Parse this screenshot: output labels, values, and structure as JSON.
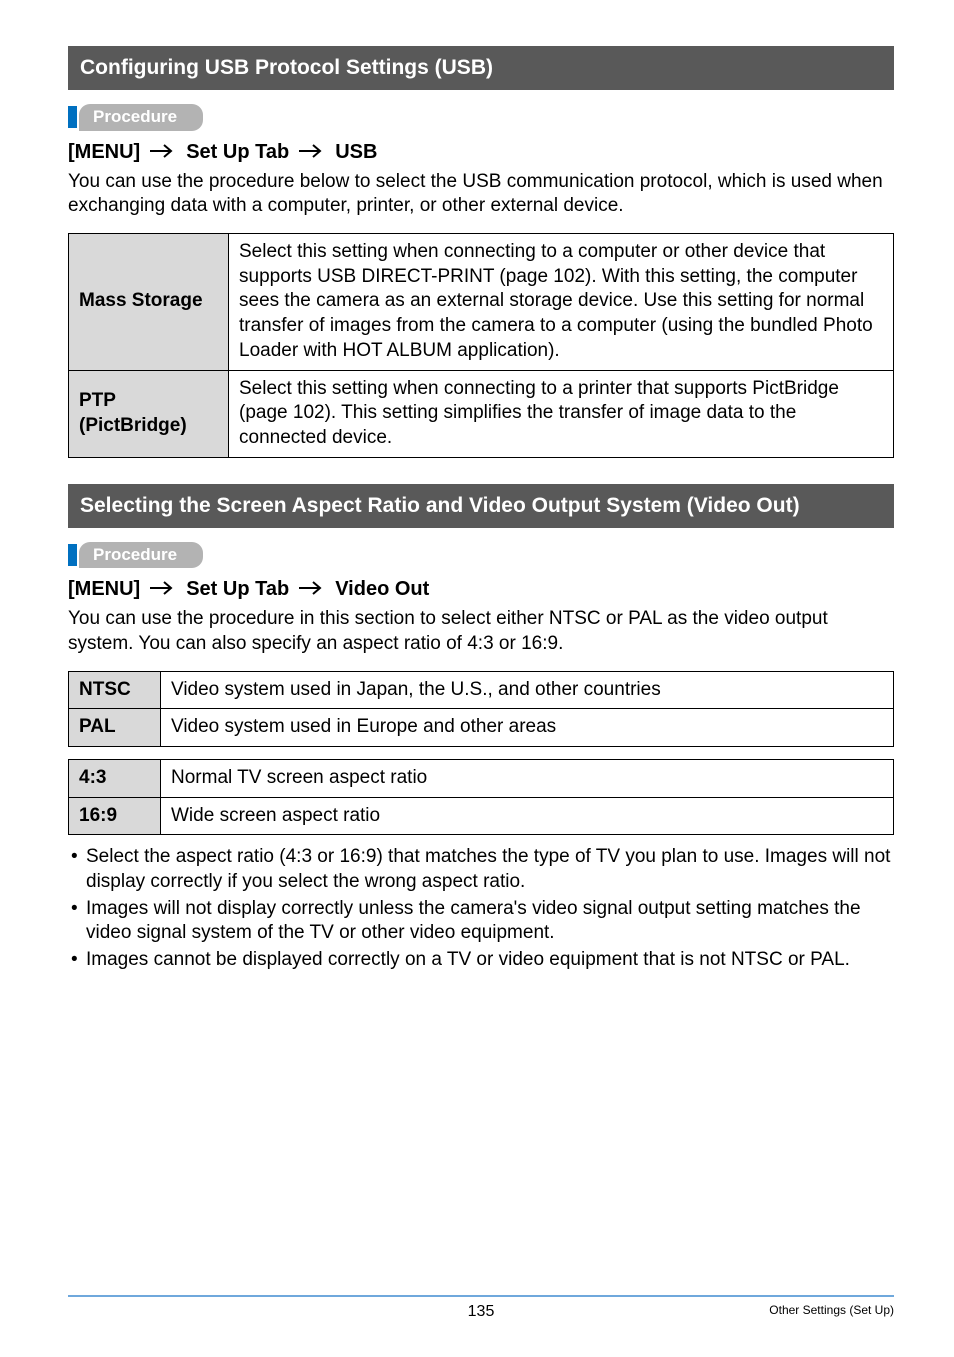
{
  "section1": {
    "title": "Configuring USB Protocol Settings (USB)",
    "procedure_label": "Procedure",
    "menu_parts": [
      "[MENU]",
      "Set Up Tab",
      "USB"
    ],
    "intro": "You can use the procedure below to select the USB communication protocol, which is used when exchanging data with a computer, printer, or other external device.",
    "rows": [
      {
        "label": "Mass Storage",
        "desc": "Select this setting when connecting to a computer or other device that supports USB DIRECT-PRINT (page 102). With this setting, the computer sees the camera as an external storage device. Use this setting for normal transfer of images from the camera to a computer (using the bundled Photo Loader with HOT ALBUM application)."
      },
      {
        "label": "PTP (PictBridge)",
        "desc": "Select this setting when connecting to a printer that supports PictBridge (page 102). This setting simplifies the transfer of image data to the connected device."
      }
    ]
  },
  "section2": {
    "title": "Selecting the Screen Aspect Ratio and Video Output System (Video Out)",
    "procedure_label": "Procedure",
    "menu_parts": [
      "[MENU]",
      "Set Up Tab",
      "Video Out"
    ],
    "intro": "You can use the procedure in this section to select either NTSC or PAL as the video output system. You can also specify an aspect ratio of 4:3 or 16:9.",
    "tableA": [
      {
        "label": "NTSC",
        "desc": "Video system used in Japan, the U.S., and other countries"
      },
      {
        "label": "PAL",
        "desc": "Video system used in Europe and other areas"
      }
    ],
    "tableB": [
      {
        "label": "4:3",
        "desc": "Normal TV screen aspect ratio"
      },
      {
        "label": "16:9",
        "desc": "Wide screen aspect ratio"
      }
    ],
    "bullets": [
      "Select the aspect ratio (4:3 or 16:9) that matches the type of TV you plan to use. Images will not display correctly if you select the wrong aspect ratio.",
      "Images will not display correctly unless the camera's video signal output setting matches the video signal system of the TV or other video equipment.",
      "Images cannot be displayed correctly on a TV or video equipment that is not NTSC or PAL."
    ]
  },
  "footer": {
    "page_number": "135",
    "section_name": "Other Settings (Set Up)"
  }
}
